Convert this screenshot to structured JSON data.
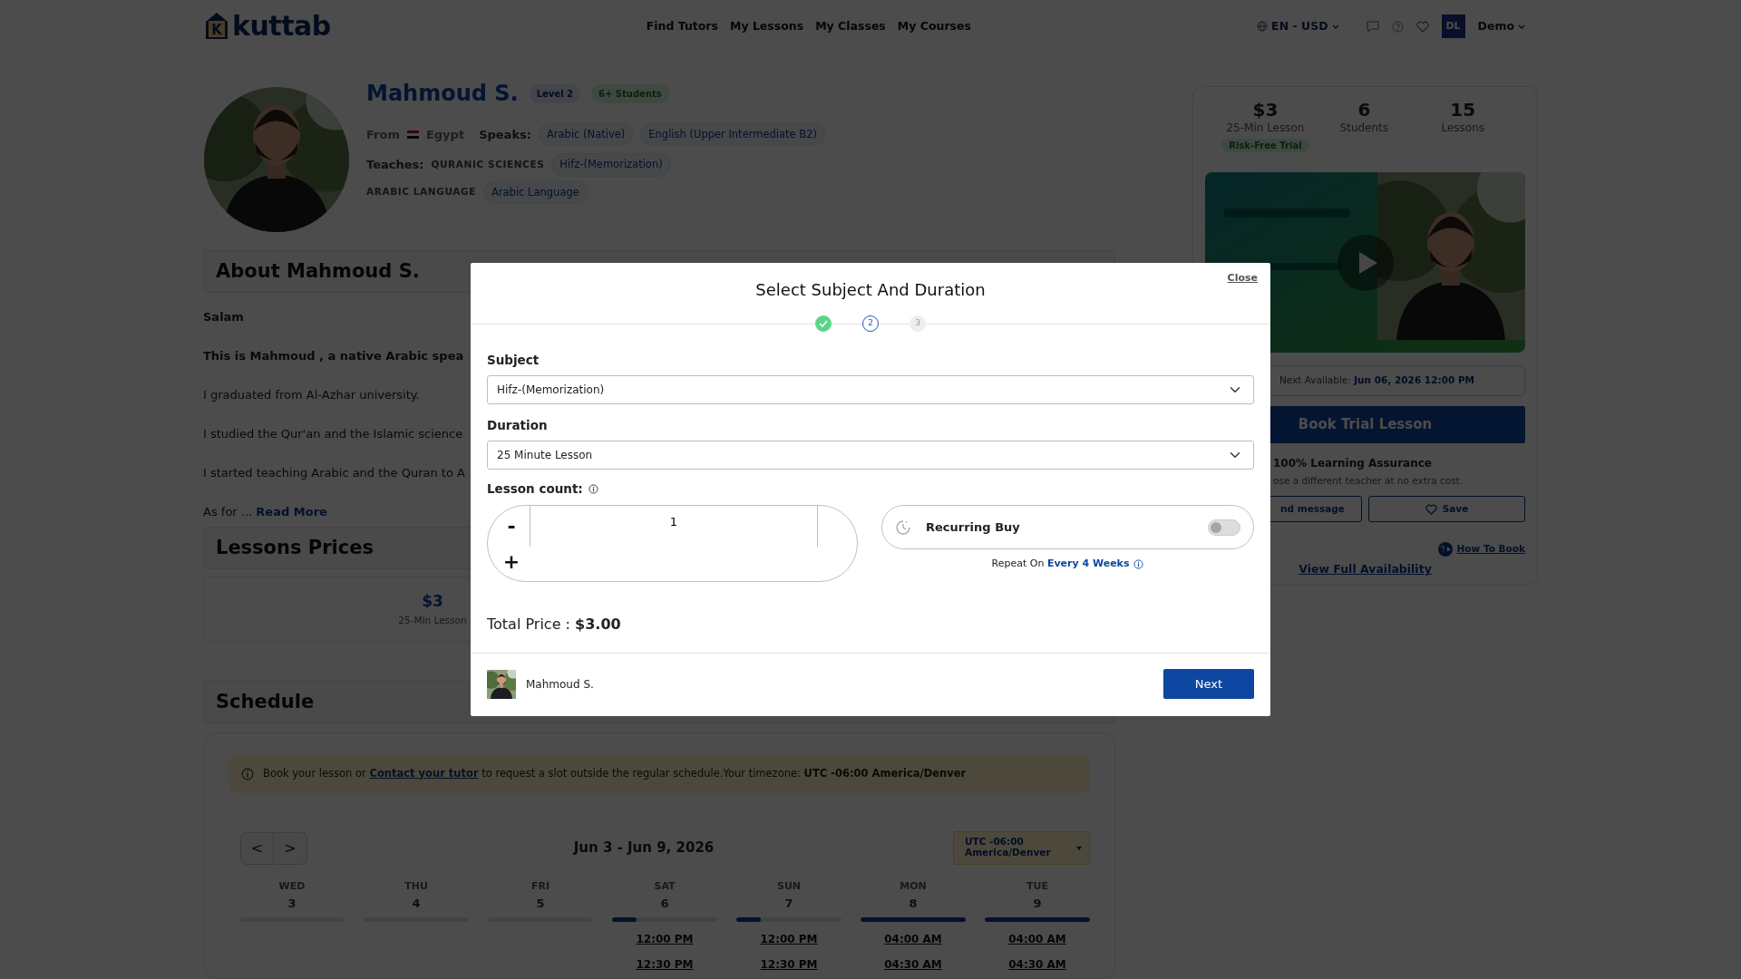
{
  "nav": {
    "logo_letter": "K",
    "logo_text": "kuttab",
    "links": [
      "Find Tutors",
      "My Lessons",
      "My Classes",
      "My Courses"
    ],
    "locale": "EN - USD",
    "avatar_initials": "DL",
    "user": "Demo"
  },
  "profile": {
    "name": "Mahmoud S.",
    "badges": [
      {
        "text": "Level 2",
        "kind": "level"
      },
      {
        "text": "6+ Students",
        "kind": "students"
      }
    ],
    "from_label": "From",
    "country": "Egypt",
    "speaks_label": "Speaks:",
    "languages": [
      "Arabic (Native)",
      "English (Upper Intermediate B2)"
    ],
    "teaches_label": "Teaches:",
    "subjects": [
      {
        "category": "QURANIC SCIENCES",
        "items": [
          "Hifz-(Memorization)"
        ]
      },
      {
        "category": "ARABIC LANGUAGE",
        "items": [
          "Arabic Language"
        ]
      }
    ]
  },
  "about": {
    "title": "About Mahmoud S.",
    "paragraphs": [
      {
        "text": "Salam",
        "bold": true
      },
      {
        "text": "This is Mahmoud , a native Arabic spea",
        "bold": true
      },
      {
        "text": "I graduated from Al-Azhar university.",
        "bold": false
      },
      {
        "text": "I studied the Qur'an and the Islamic science",
        "bold": false
      },
      {
        "text": "I started teaching Arabic and the Quran to A",
        "bold": false
      }
    ],
    "last_line": "As for ...",
    "read_more": "Read More"
  },
  "prices": {
    "title": "Lessons Prices",
    "items": [
      {
        "price": "$3",
        "duration": "25-Min Lesson"
      }
    ]
  },
  "schedule": {
    "title": "Schedule",
    "notice_before": "Book your lesson or",
    "notice_link": "Contact your tutor",
    "notice_after": "to request a slot outside the regular schedule.Your timezone: **UTC -06:00 America/Denver**",
    "prev": "<",
    "next": ">",
    "range": "Jun 3 - Jun 9, 2026",
    "timezone": "UTC -06:00 America/Denver",
    "days": [
      {
        "name": "WED",
        "date": "3",
        "level": 0
      },
      {
        "name": "THU",
        "date": "4",
        "level": 0
      },
      {
        "name": "FRI",
        "date": "5",
        "level": 0
      },
      {
        "name": "SAT",
        "date": "6",
        "level": 0.23,
        "times": [
          "12:00 PM",
          "12:30 PM"
        ]
      },
      {
        "name": "SUN",
        "date": "7",
        "level": 0.23,
        "times": [
          "12:00 PM",
          "12:30 PM"
        ]
      },
      {
        "name": "MON",
        "date": "8",
        "level": 1,
        "times": [
          "04:00 AM",
          "04:30 AM"
        ]
      },
      {
        "name": "TUE",
        "date": "9",
        "level": 1,
        "times": [
          "04:00 AM",
          "04:30 AM"
        ]
      }
    ]
  },
  "card": {
    "stats": [
      {
        "value": "$3",
        "label": "25-Min Lesson",
        "badge": "Risk-Free Trial"
      },
      {
        "value": "6",
        "label": "Students"
      },
      {
        "value": "15",
        "label": "Lessons"
      }
    ],
    "next_available_label": "Next Available:",
    "next_available": "Jun 06, 2026 12:00 PM",
    "book_button": "Book Trial Lesson",
    "assurance_title": "100% Learning Assurance",
    "assurance_text": "ose a different teacher at no extra cost.",
    "message_button": "nd message",
    "save_button": "Save",
    "how_to_book": "How To Book",
    "availability_link": "View Full Availability"
  },
  "modal": {
    "title": "Select Subject And Duration",
    "close": "Close",
    "steps": [
      {
        "completed": true,
        "selected": false
      },
      {
        "label": "2",
        "completed": false,
        "selected": true
      },
      {
        "label": "3",
        "completed": false,
        "selected": false
      }
    ],
    "subject_label": "Subject",
    "subject": "Hifz-(Memorization)",
    "duration_label": "Duration",
    "duration": "25 Minute Lesson",
    "count_label": "Lesson count:",
    "minus": "-",
    "count": "1",
    "plus": "+",
    "recurring_label": "Recurring Buy",
    "recurring_on": false,
    "repeat_label": "Repeat On",
    "repeat_value": "Every 4 Weeks",
    "total": "Total Price : **$3.00**",
    "tutor": "Mahmoud S.",
    "next": "Next"
  }
}
